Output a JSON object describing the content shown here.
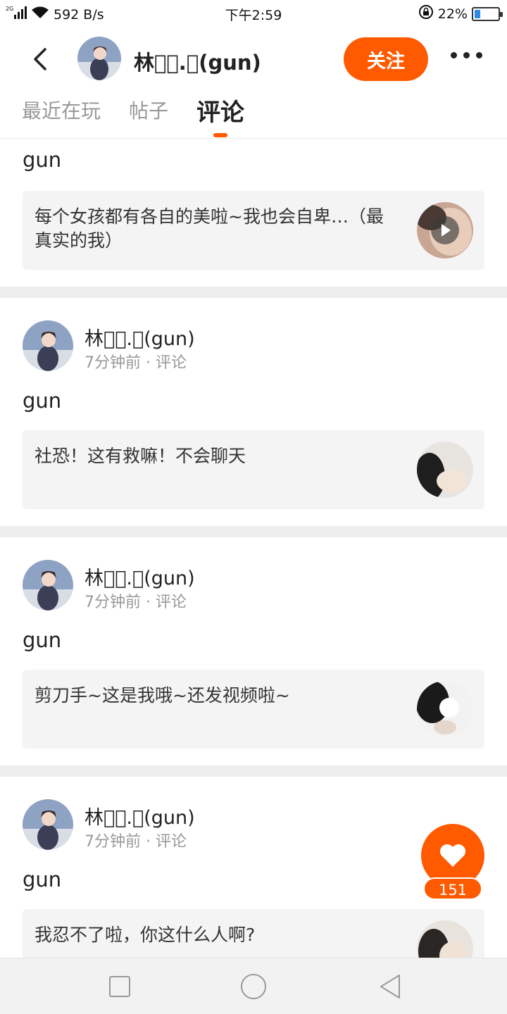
{
  "status_bar": {
    "network": "2G",
    "speed": "592 B/s",
    "time": "下午2:59",
    "battery": "22%",
    "battery_level": 0.22
  },
  "header": {
    "name": "林澈ᷤ.ᷤ(gun)",
    "follow_label": "关注"
  },
  "tabs": [
    {
      "label": "最近在玩",
      "active": false
    },
    {
      "label": "帖子",
      "active": false
    },
    {
      "label": "评论",
      "active": true
    }
  ],
  "first_partial": {
    "text": "gun",
    "quote": "每个女孩都有各自的美啦~我也会自卑…（最真实的我）",
    "has_video": true
  },
  "posts": [
    {
      "author": "林澈ᷤ.ᷤ(gun)",
      "time": "7分钟前",
      "type": "评论",
      "text": "gun",
      "quote": "社恐！这有救嘛！不会聊天"
    },
    {
      "author": "林澈ᷤ.ᷤ(gun)",
      "time": "7分钟前",
      "type": "评论",
      "text": "gun",
      "quote": "剪刀手~这是我哦~还发视频啦~"
    },
    {
      "author": "林澈ᷤ.ᷤ(gun)",
      "time": "7分钟前",
      "type": "评论",
      "text": "gun",
      "quote": "我忍不了啦，你这什么人啊?"
    }
  ],
  "meta_separator": "·",
  "like": {
    "count": "151"
  },
  "colors": {
    "accent": "#ff5a00",
    "battery": "#2b8ae6"
  },
  "icons": [
    "signal-icon",
    "wifi-icon",
    "lock-rotation-icon",
    "battery-icon",
    "back-icon",
    "more-icon",
    "play-icon",
    "heart-icon",
    "nav-square-icon",
    "nav-circle-icon",
    "nav-back-icon"
  ]
}
